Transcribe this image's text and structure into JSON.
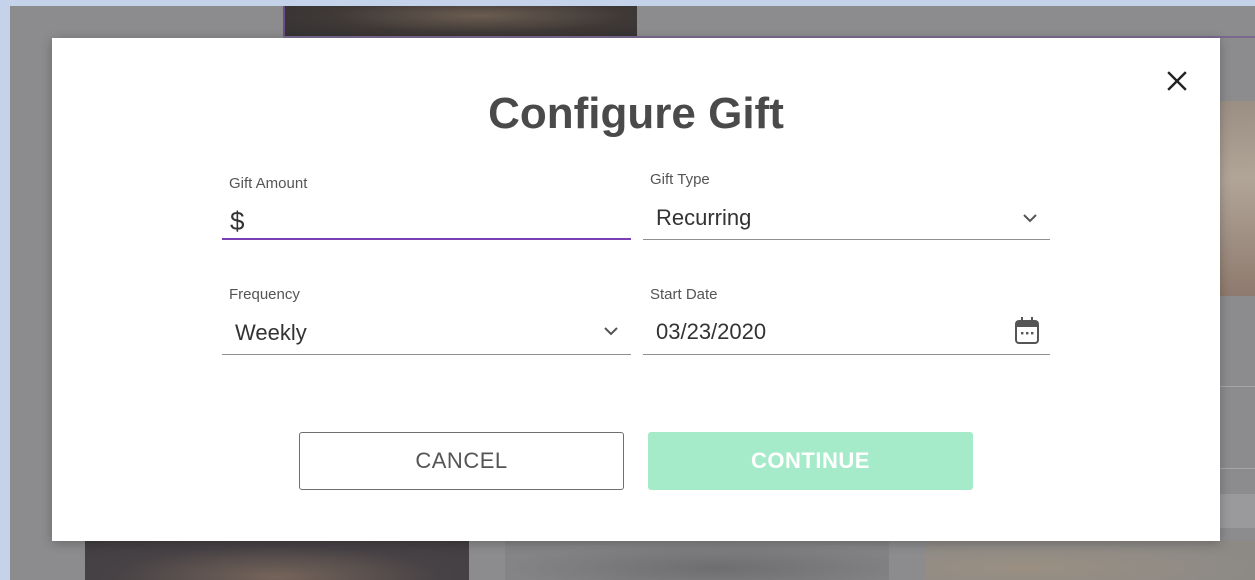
{
  "modal": {
    "title": "Configure Gift",
    "close_icon": "close-icon"
  },
  "form": {
    "gift_amount": {
      "label": "Gift Amount",
      "value": "$"
    },
    "gift_type": {
      "label": "Gift Type",
      "value": "Recurring",
      "icon": "chevron-down-icon"
    },
    "frequency": {
      "label": "Frequency",
      "value": "Weekly",
      "icon": "chevron-down-icon"
    },
    "start_date": {
      "label": "Start Date",
      "value": "03/23/2020",
      "icon": "calendar-icon"
    }
  },
  "actions": {
    "cancel_label": "CANCEL",
    "continue_label": "CONTINUE"
  },
  "colors": {
    "accent": "#7b3fb5",
    "continue_disabled": "#a6ebc9",
    "title_text": "#4a4a4a"
  }
}
